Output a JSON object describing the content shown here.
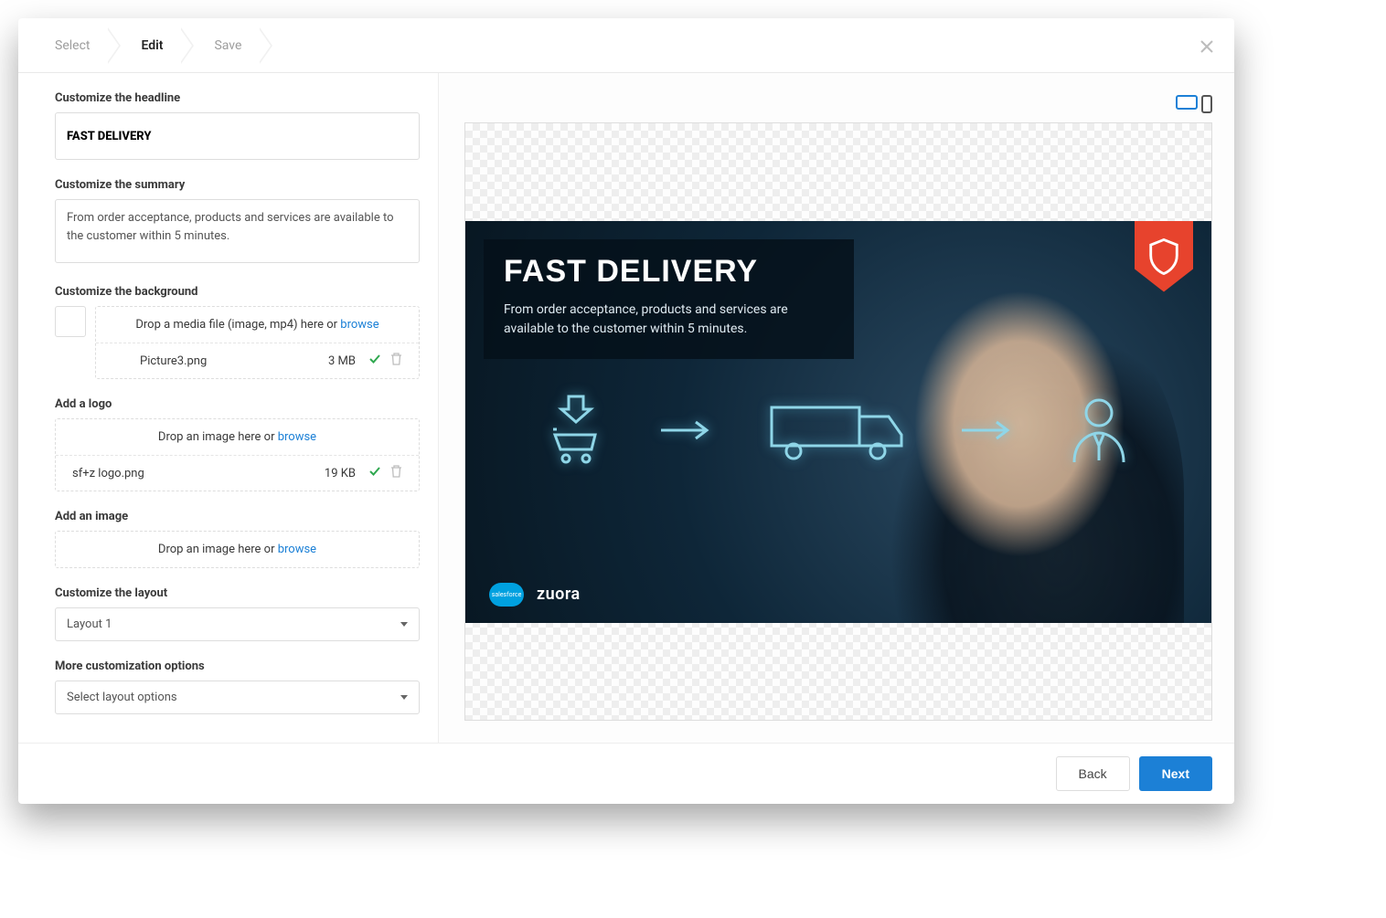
{
  "steps": {
    "select": "Select",
    "edit": "Edit",
    "save": "Save",
    "active": "edit"
  },
  "sidebar": {
    "headline_label": "Customize the headline",
    "headline_value": "FAST DELIVERY",
    "summary_label": "Customize the summary",
    "summary_value": "From order acceptance, products and services are available to the customer within 5 minutes.",
    "background_label": "Customize the background",
    "background_dz_text": "Drop a media file (image, mp4) here or ",
    "browse_label": "browse",
    "background_file": {
      "name": "Picture3.png",
      "size": "3 MB"
    },
    "logo_label": "Add a logo",
    "logo_dz_text": "Drop an image here or ",
    "logo_file": {
      "name": "sf+z logo.png",
      "size": "19 KB"
    },
    "image_label": "Add an image",
    "image_dz_text": "Drop an image here or ",
    "layout_label": "Customize the layout",
    "layout_value": "Layout 1",
    "more_label": "More customization options",
    "more_value": "Select layout options"
  },
  "preview": {
    "hero_title": "FAST DELIVERY",
    "hero_summary": "From order acceptance, products and services are available to the customer within 5 minutes.",
    "brand_sf": "salesforce",
    "brand_zuora": "zuora"
  },
  "footer": {
    "back": "Back",
    "next": "Next"
  }
}
